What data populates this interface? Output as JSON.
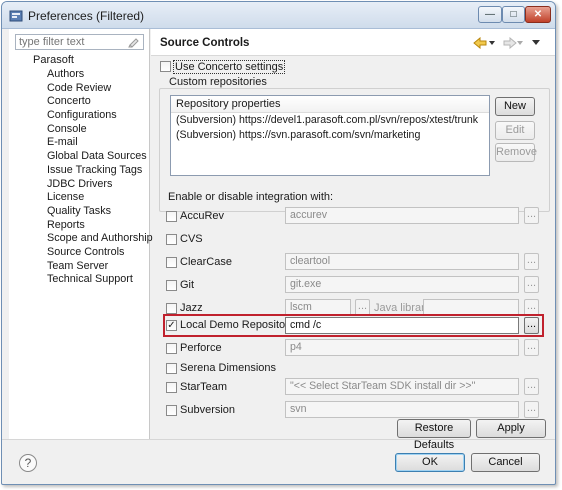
{
  "window": {
    "title": "Preferences (Filtered)"
  },
  "left": {
    "filter_placeholder": "type filter text",
    "root": "Parasoft",
    "items": [
      "Authors",
      "Code Review",
      "Concerto",
      "Configurations",
      "Console",
      "E-mail",
      "Global Data Sources",
      "Issue Tracking Tags",
      "JDBC Drivers",
      "License",
      "Quality Tasks",
      "Reports",
      "Scope and Authorship",
      "Source Controls",
      "Team Server",
      "Technical Support"
    ]
  },
  "page": {
    "title": "Source Controls",
    "use_concerto": "Use Concerto settings",
    "custom_repos": "Custom repositories",
    "repo_header": "Repository properties",
    "repos": [
      "(Subversion) https://devel1.parasoft.com.pl/svn/repos/xtest/trunk",
      "(Subversion) https://svn.parasoft.com/svn/marketing"
    ],
    "btn_new": "New",
    "btn_edit": "Edit",
    "btn_remove": "Remove",
    "enable_label": "Enable or disable integration with:",
    "scm": [
      {
        "label": "AccuRev",
        "value": "accurev",
        "checked": false
      },
      {
        "label": "CVS",
        "value": "",
        "checked": false
      },
      {
        "label": "ClearCase",
        "value": "cleartool",
        "checked": false
      },
      {
        "label": "Git",
        "value": "git.exe",
        "checked": false
      },
      {
        "label": "Jazz",
        "value": "lscm",
        "checked": false
      },
      {
        "label": "Local Demo Repository",
        "value": "cmd /c",
        "checked": true
      },
      {
        "label": "Perforce",
        "value": "p4",
        "checked": false
      },
      {
        "label": "Serena Dimensions",
        "value": "",
        "checked": false
      },
      {
        "label": "StarTeam",
        "value": "\"<< Select StarTeam SDK install dir >>\"",
        "checked": false
      },
      {
        "label": "Subversion",
        "value": "svn",
        "checked": false
      }
    ],
    "java_library": "Java library",
    "browse": "...",
    "restore_defaults": "Restore Defaults",
    "apply": "Apply"
  },
  "footer": {
    "ok": "OK",
    "cancel": "Cancel",
    "help": "?"
  }
}
